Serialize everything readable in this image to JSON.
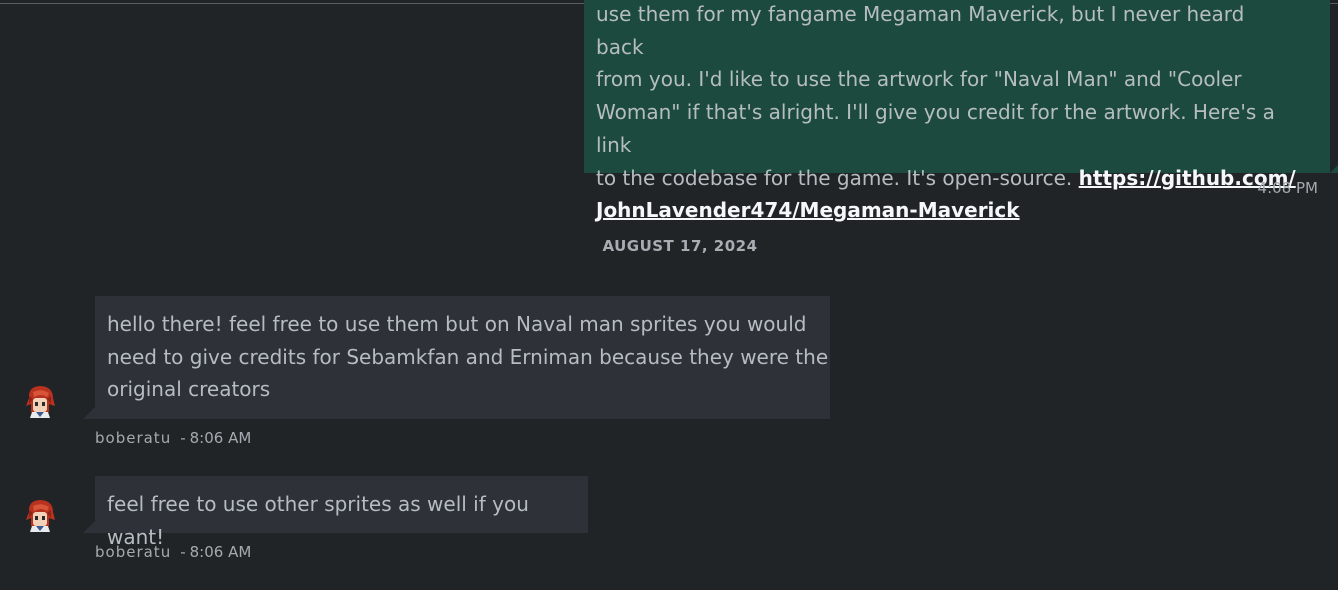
{
  "conversation": {
    "outgoing": {
      "text_lines": [
        "use them for my fangame Megaman Maverick, but I never heard back",
        "from you. I'd like to use the artwork for \"Naval Man\" and \"Cooler",
        "Woman\" if that's alright. I'll give you credit for the artwork. Here's a link",
        "to the codebase for the game. It's open-source. "
      ],
      "link_part1": "https://github.com/",
      "link_part2": "JohnLavender474/Megaman-Maverick",
      "time": "4:08 PM"
    },
    "date_separator": "AUGUST 17, 2024",
    "incoming": [
      {
        "lines": [
          "hello there! feel free to use them but on Naval man sprites you would",
          "need to give credits for Sebamkfan and Erniman because they were the",
          "original creators"
        ],
        "author": "boberatu",
        "separator": "-",
        "time": "8:06 AM",
        "avatar_icon": "avatar-red-hair-sprite"
      },
      {
        "lines": [
          "feel free to use other sprites as well if you want!"
        ],
        "author": "boberatu",
        "separator": "-",
        "time": "8:06 AM",
        "avatar_icon": "avatar-red-hair-sprite"
      }
    ]
  },
  "colors": {
    "background": "#212427",
    "outgoing_bubble": "#1d4a3e",
    "incoming_bubble": "#2e3138",
    "text": "#b6bdc2"
  }
}
